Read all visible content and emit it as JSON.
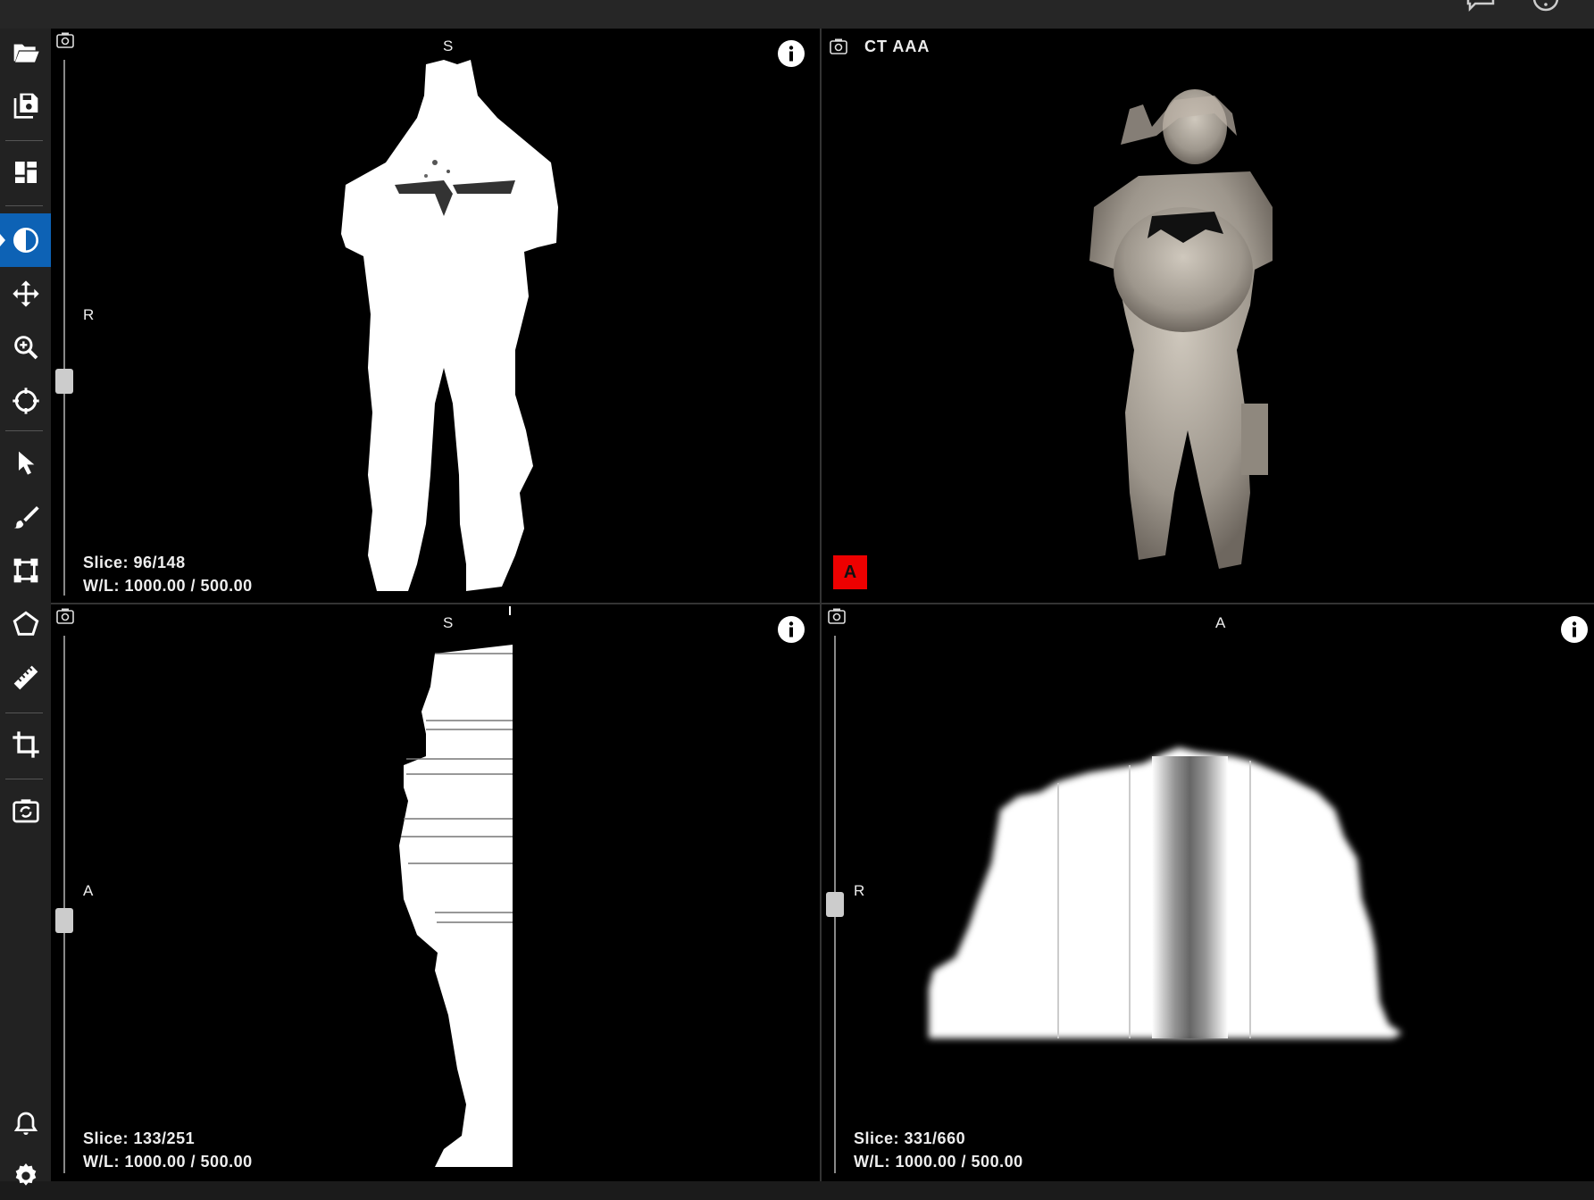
{
  "viewports": {
    "top_left": {
      "orient_top": "S",
      "orient_left": "R",
      "slice": "Slice: 96/148",
      "wl": "W/L: 1000.00 / 500.00",
      "slider_fraction": 0.6
    },
    "top_right": {
      "title": "CT AAA",
      "badge": "A"
    },
    "bottom_left": {
      "orient_top": "S",
      "orient_left": "A",
      "slice": "Slice: 133/251",
      "wl": "W/L: 1000.00 / 500.00",
      "slider_fraction": 0.53
    },
    "bottom_right": {
      "orient_top": "A",
      "orient_left": "R",
      "slice": "Slice: 331/660",
      "wl": "W/L: 1000.00 / 500.00",
      "slider_fraction": 0.5
    }
  },
  "sidebar": {
    "items": [
      {
        "icon": "folder-open-icon"
      },
      {
        "icon": "save-icon"
      },
      {
        "icon": "layout-icon"
      },
      {
        "icon": "contrast-icon",
        "active": true
      },
      {
        "icon": "move-icon"
      },
      {
        "icon": "zoom-icon"
      },
      {
        "icon": "crosshair-icon"
      },
      {
        "icon": "pointer-icon"
      },
      {
        "icon": "brush-icon"
      },
      {
        "icon": "bounding-box-icon"
      },
      {
        "icon": "polygon-icon"
      },
      {
        "icon": "ruler-icon"
      },
      {
        "icon": "crop-icon"
      },
      {
        "icon": "camera-reset-icon"
      },
      {
        "icon": "bell-icon"
      },
      {
        "icon": "settings-icon"
      }
    ]
  },
  "colors": {
    "accent": "#0d62b5",
    "badge": "#ee0000",
    "viewport_bg": "#000000",
    "sidebar_bg": "#222222"
  }
}
